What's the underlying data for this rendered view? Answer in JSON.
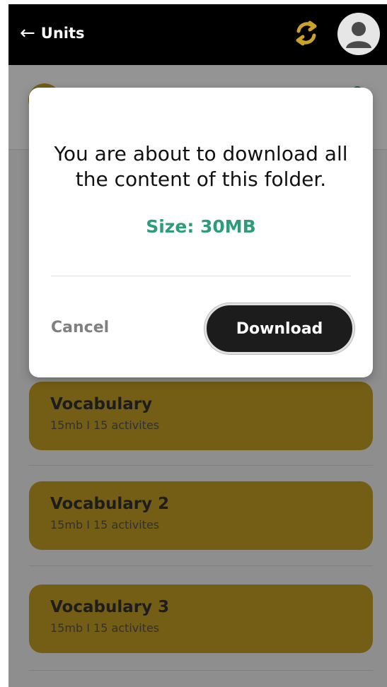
{
  "header": {
    "back_arrow": "←",
    "title": "Units",
    "sync_icon": "sync-icon",
    "avatar_icon": "user-avatar-icon"
  },
  "units": [
    {
      "title": "Vocabulary",
      "meta": "15mb  I  15 activites"
    },
    {
      "title": "Vocabulary 2",
      "meta": "15mb  I  15 activites"
    },
    {
      "title": "Vocabulary 3",
      "meta": "15mb  I  15 activites"
    }
  ],
  "dialog": {
    "message": "You are about to download all the content of this folder.",
    "size": "Size: 30MB",
    "cancel_label": "Cancel",
    "download_label": "Download"
  },
  "colors": {
    "topbar": "#000000",
    "accent_gold": "#c9a227",
    "size_green": "#2e9c7a",
    "primary_button": "#1c1c1c",
    "overlay": "rgba(0,0,0,0.42)"
  }
}
